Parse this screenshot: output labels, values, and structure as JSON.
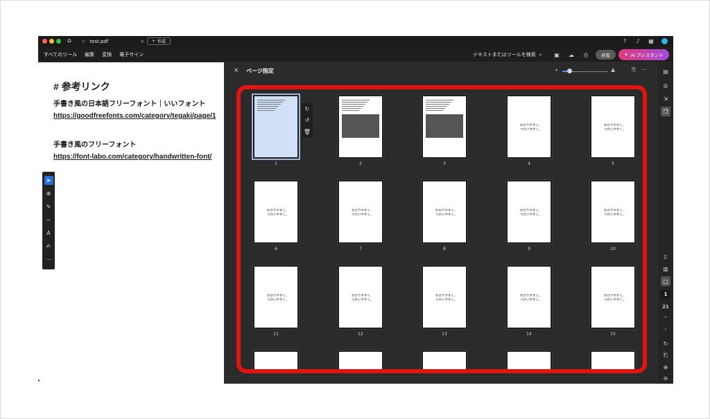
{
  "titlebar": {
    "tab_label": "test.pdf",
    "new_tab_label": "作成",
    "colors": {
      "close": "#ff5f57",
      "min": "#febc2e",
      "max": "#28c840"
    }
  },
  "menubar": {
    "items": [
      "すべてのツール",
      "編集",
      "変換",
      "電子サイン"
    ],
    "search_label": "テキストまたはツールを検索",
    "share_label": "共有",
    "ai_label": "AI アシスタント"
  },
  "document": {
    "heading": "# 参考リンク",
    "line1": "手書き風の日本語フリーフォント｜いいフォント",
    "link1": "https://goodfreefonts.com/category/tegaki/page/1",
    "line2": "手書き風のフリーフォント",
    "link2": "https://font-labo.com/category/handwritten-font/"
  },
  "panel": {
    "title": "ページ指定",
    "zoom_fraction": 0.15,
    "pages": [
      {
        "num": "1",
        "t1": "",
        "t2": ""
      },
      {
        "num": "2",
        "t1": "",
        "t2": ""
      },
      {
        "num": "3",
        "t1": "",
        "t2": ""
      },
      {
        "num": "4",
        "t1": "",
        "t2": "わかりやすく、\nつかいやすく。"
      },
      {
        "num": "5",
        "t1": "",
        "t2": "わかりやすく、\nつかいやすく。"
      },
      {
        "num": "6",
        "t1": "",
        "t2": "わかりやすく、\nつかいやすく。"
      },
      {
        "num": "7",
        "t1": "",
        "t2": "わかりやすく、\nつかいやすく。"
      },
      {
        "num": "8",
        "t1": "",
        "t2": "わかりやすく、\nつかいやすく。"
      },
      {
        "num": "9",
        "t1": "",
        "t2": "わかりやすく、\nつかいやすく。"
      },
      {
        "num": "10",
        "t1": "",
        "t2": "わかりやすく、\nつかいやすく。"
      },
      {
        "num": "11",
        "t1": "",
        "t2": "わかりやすく、\nつかいやすく。"
      },
      {
        "num": "12",
        "t1": "",
        "t2": "わかりやすく、\nつかいやすく。"
      },
      {
        "num": "13",
        "t1": "",
        "t2": "わかりやすく、\nつかいやすく。"
      },
      {
        "num": "14",
        "t1": "",
        "t2": "わかりやすく、\nつかいやすく。"
      },
      {
        "num": "15",
        "t1": "",
        "t2": "わかりやすく、\nつかいやすく。"
      },
      {
        "num": "",
        "t1": "",
        "t2": ""
      },
      {
        "num": "",
        "t1": "",
        "t2": ""
      },
      {
        "num": "",
        "t1": "",
        "t2": ""
      },
      {
        "num": "",
        "t1": "",
        "t2": ""
      },
      {
        "num": "",
        "t1": "",
        "t2": ""
      }
    ]
  },
  "sidebar": {
    "current_page": "1",
    "total_pages": "21"
  },
  "icons": [
    "home-icon",
    "star-icon",
    "help-icon",
    "bell-icon",
    "search-icon",
    "save-icon",
    "upload-icon",
    "print-icon",
    "select-icon",
    "zoom-icon",
    "pen-icon",
    "lasso-icon",
    "text-box-icon",
    "sign-icon",
    "more-icon",
    "rotate-cw-icon",
    "rotate-ccw-icon",
    "trash-icon",
    "chevron-up-icon",
    "chevron-down-icon"
  ],
  "colors": {
    "accent": "#2a6fdb",
    "highlight": "#e3140f",
    "panel": "#2b2b2b"
  }
}
